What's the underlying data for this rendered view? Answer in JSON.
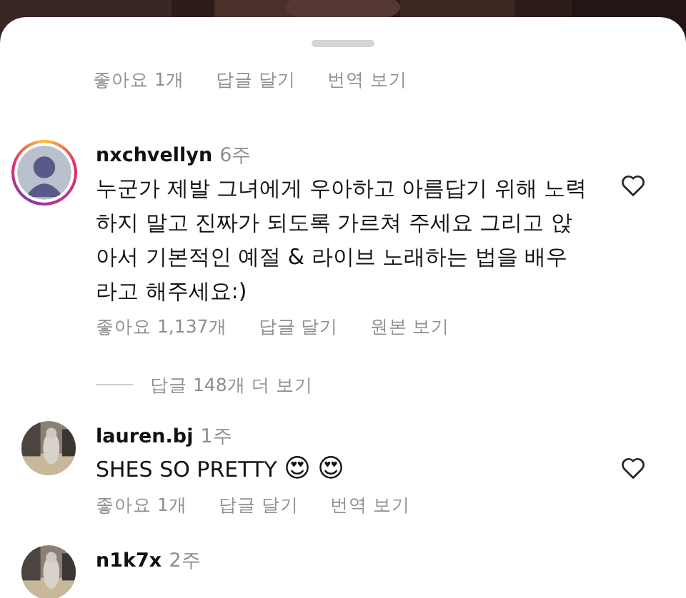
{
  "top_actions": {
    "likes": "좋아요 1개",
    "reply": "답글 달기",
    "translate": "번역 보기"
  },
  "comments": [
    {
      "username": "nxchvellyn",
      "time": "6주",
      "story_ring": true,
      "text": "누군가 제발 그녀에게 우아하고 아름답기 위해 노력하지 말고 진짜가 되도록 가르쳐 주세요 그리고 앉아서 기본적인 예절 & 라이브 노래하는 법을 배우라고 해주세요:)",
      "liked": false,
      "likes": "좋아요 1,137개",
      "reply": "답글 달기",
      "translate": "원본 보기",
      "more_replies": "답글 148개 더 보기"
    },
    {
      "username": "lauren.bj",
      "time": "1주",
      "story_ring": false,
      "text": "SHES SO PRETTY",
      "emojis": [
        "😍",
        "😍"
      ],
      "liked": false,
      "likes": "좋아요 1개",
      "reply": "답글 달기",
      "translate": "번역 보기"
    },
    {
      "username": "n1k7x",
      "time": "2주",
      "story_ring": false
    }
  ]
}
